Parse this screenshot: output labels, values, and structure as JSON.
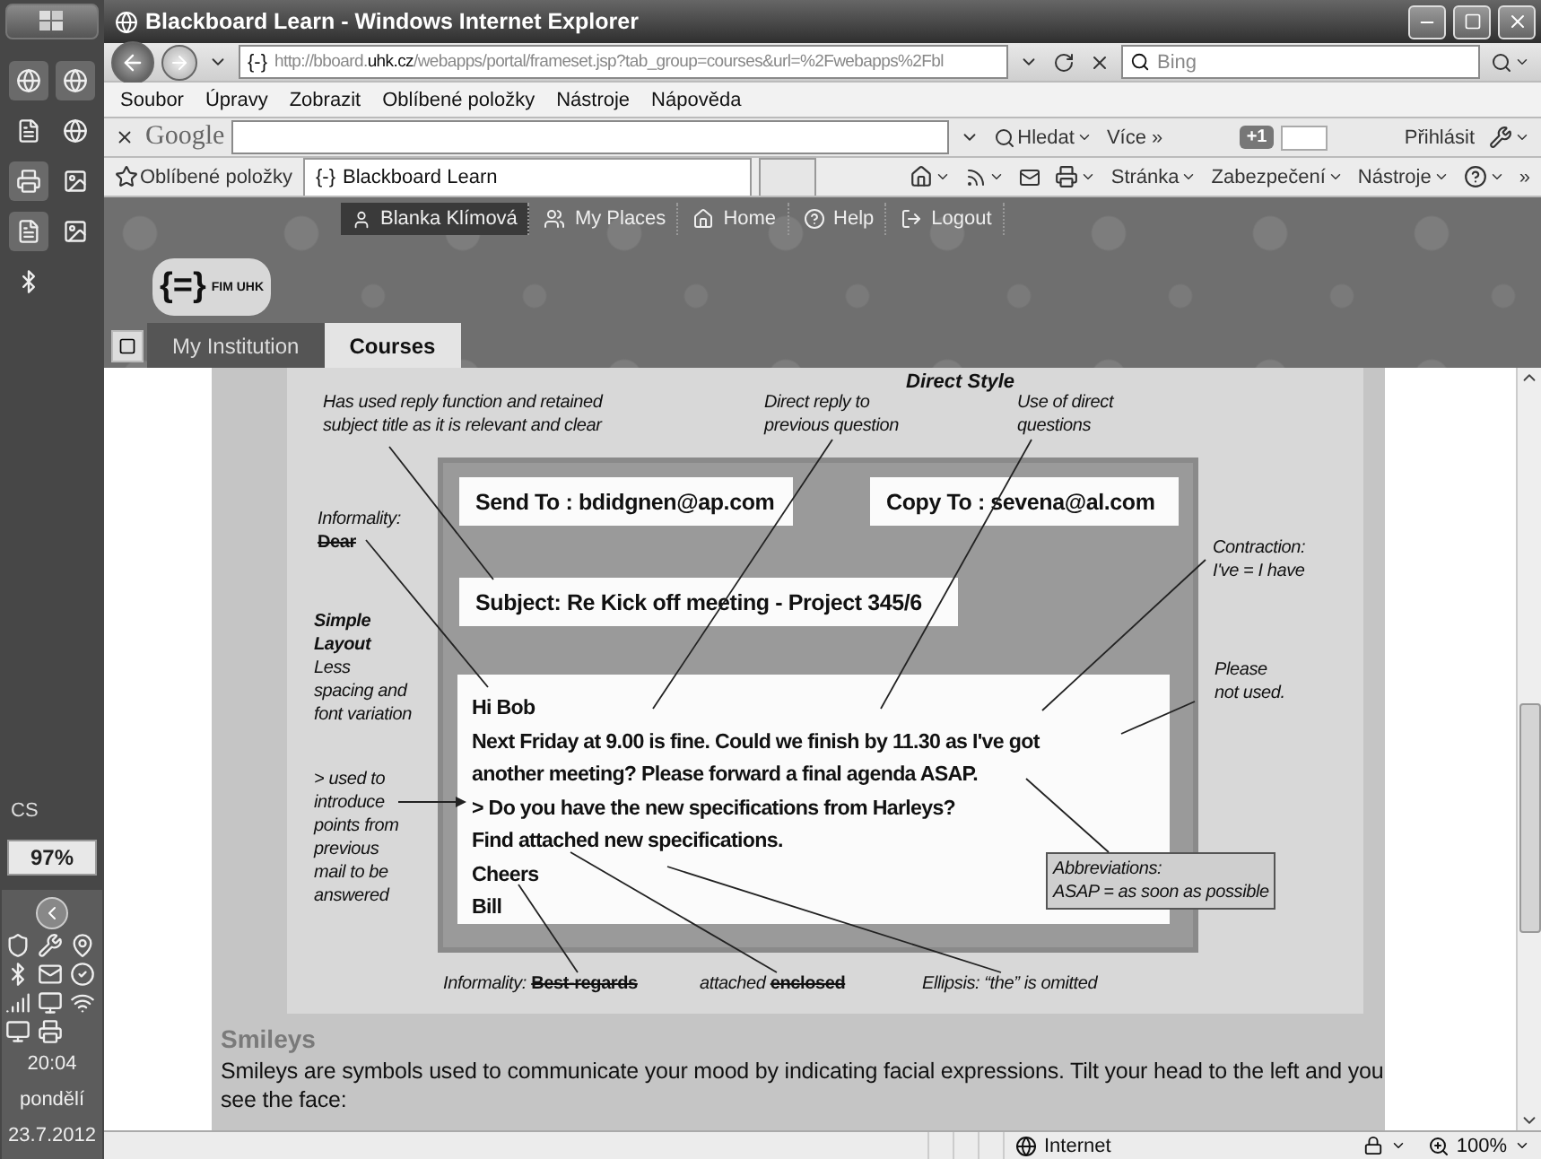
{
  "taskbar": {
    "language": "CS",
    "battery": "97%",
    "clock": {
      "time": "20:04",
      "day": "pondělí",
      "date": "23.7.2012"
    }
  },
  "window": {
    "title": "Blackboard Learn - Windows Internet Explorer"
  },
  "address_bar": {
    "favicon": "{-}",
    "url": {
      "prefix": "http://bboard.",
      "domain": "uhk.cz",
      "path": "/webapps/portal/frameset.jsp?tab_group=courses&url=%2Fwebapps%2Fbl"
    },
    "search_placeholder": "Bing"
  },
  "menu": [
    "Soubor",
    "Úpravy",
    "Zobrazit",
    "Oblíbené položky",
    "Nástroje",
    "Nápověda"
  ],
  "google_toolbar": {
    "logo": "Google",
    "search_button": "Hledat",
    "more": "Více »",
    "plus_one": "+1",
    "sign_in": "Přihlásit"
  },
  "favorites_bar": {
    "favorites": "Oblíbené položky",
    "tabs": [
      {
        "icon": "{-}",
        "label": "Blackboard Learn",
        "selected": true
      }
    ],
    "commands": [
      "Stránka",
      "Zabezpečení",
      "Nástroje"
    ],
    "overflow": "»"
  },
  "site_header": {
    "logo_mark": "{=}",
    "logo_text": "FIM UHK",
    "user": "Blanka Klímová",
    "nav": [
      "My Places",
      "Home",
      "Help",
      "Logout"
    ],
    "tabs": [
      {
        "label": "My Institution",
        "selected": false
      },
      {
        "label": "Courses",
        "selected": true
      }
    ]
  },
  "figure": {
    "title": "Direct Style",
    "email": {
      "send_to": "Send To : bdidgnen@ap.com",
      "copy_to": "Copy To : sevena@al.com",
      "subject": "Subject: Re Kick off meeting - Project 345/6",
      "body": [
        "Hi Bob",
        "Next Friday at 9.00 is fine. Could we finish by 11.30 as I've got",
        "another meeting? Please forward a final agenda ASAP.",
        "> Do you have the new specifications from Harleys?",
        "Find attached new specifications.",
        "Cheers",
        "Bill"
      ]
    },
    "annotations": [
      {
        "kind": "note",
        "lines": [
          "Has used reply function and retained",
          "subject title as it is relevant and clear"
        ]
      },
      {
        "kind": "note",
        "lines": [
          "Direct reply to",
          "previous question"
        ]
      },
      {
        "kind": "note",
        "lines": [
          "Use of direct",
          "questions"
        ]
      },
      {
        "kind": "note",
        "lines": [
          "Informality:"
        ],
        "struck": "Dear"
      },
      {
        "kind": "note",
        "lines": [
          "Contraction:",
          "I've = I have"
        ]
      },
      {
        "kind": "note",
        "heading": [
          "Simple",
          "Layout"
        ],
        "lines": [
          "Less",
          "spacing and",
          "font variation"
        ]
      },
      {
        "kind": "note",
        "lines": [
          "Please",
          "not used."
        ]
      },
      {
        "kind": "note",
        "lines": [
          "> used to",
          "introduce",
          "points from",
          "previous",
          "mail to be",
          "answered"
        ]
      },
      {
        "kind": "boxed",
        "lines": [
          "Abbreviations:",
          "ASAP = as soon as possible"
        ]
      },
      {
        "kind": "note",
        "lines": [
          "Informality:"
        ],
        "struck": "Best-regards"
      },
      {
        "kind": "note",
        "lines": [
          "attached"
        ],
        "struck": "enclosed"
      },
      {
        "kind": "note",
        "lines": [
          "Ellipsis: “the” is omitted"
        ]
      }
    ]
  },
  "section": {
    "heading": "Smileys",
    "text": "Smileys are symbols used to communicate your mood by indicating facial expressions. Tilt your head to the left and you see the face:"
  },
  "status_bar": {
    "zone": "Internet",
    "zoom": "100%"
  }
}
